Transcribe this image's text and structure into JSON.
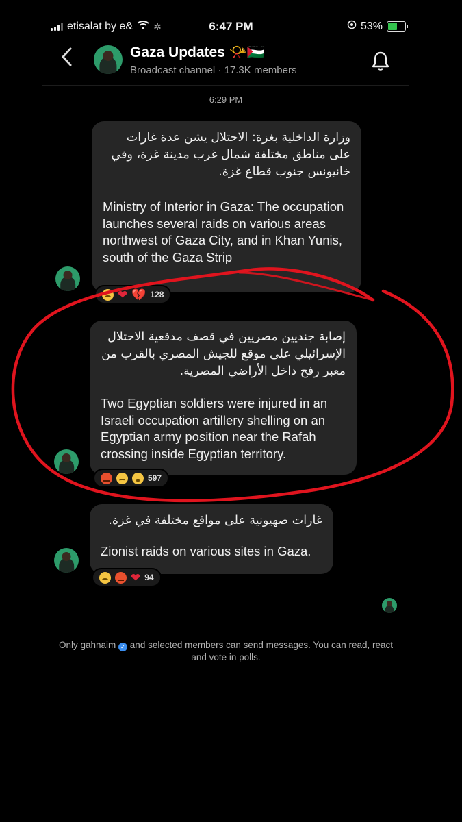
{
  "status_bar": {
    "carrier": "etisalat by e&",
    "time": "6:47 PM",
    "battery": "53%",
    "battery_level": 0.53
  },
  "header": {
    "channel_name": "Gaza Updates 📯🇵🇸",
    "subtitle": "Broadcast channel · 17.3K members"
  },
  "timestamp": "6:29 PM",
  "messages": [
    {
      "arabic": "وزارة الداخلية بغزة: الاحتلال يشن عدة غارات على مناطق مختلفة شمال غرب مدينة غزة، وفي خانيونس جنوب قطاع غزة.",
      "english": "Ministry of Interior in Gaza: The occupation launches several raids on various areas northwest of Gaza City, and in Khan Yunis, south of the Gaza Strip",
      "reactions": [
        "sad-face",
        "heart",
        "broken-heart"
      ],
      "reaction_count": "128"
    },
    {
      "arabic": "إصابة جنديين مصريين في قصف مدفعية الاحتلال الإسرائيلي على موقع للجيش المصري بالقرب من معبر رفح داخل الأراضي المصرية.",
      "english": "Two Egyptian soldiers were injured in an Israeli occupation artillery shelling on an Egyptian army position near the Rafah crossing inside Egyptian territory.",
      "reactions": [
        "angry-face",
        "sad-face",
        "surprised-face"
      ],
      "reaction_count": "597"
    },
    {
      "arabic": "غارات صهيونية على مواقع مختلفة في غزة.",
      "english": "Zionist raids on various sites in Gaza.",
      "reactions": [
        "sad-face",
        "angry-face",
        "heart"
      ],
      "reaction_count": "94"
    }
  ],
  "footer": {
    "username": "Only gahnaim",
    "note": "and selected members can send messages. You can read, react and vote in polls."
  },
  "colors": {
    "background": "#000000",
    "bubble": "#262626",
    "avatar": "#2d9b6a",
    "annotation_red": "#e0141e"
  }
}
